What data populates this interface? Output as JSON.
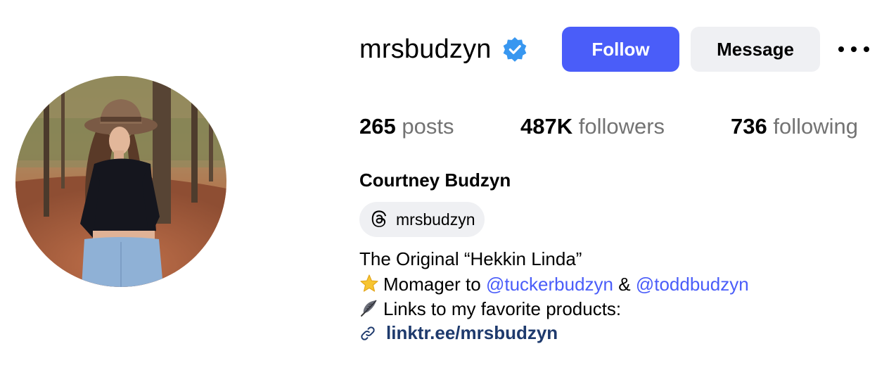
{
  "profile": {
    "username": "mrsbudzyn",
    "verified_icon": "verified-badge-icon",
    "follow_label": "Follow",
    "message_label": "Message",
    "more_icon": "more-options-icon",
    "accent_color": "#4a5df9"
  },
  "stats": {
    "posts": {
      "count": "265",
      "label": "posts"
    },
    "followers": {
      "count": "487K",
      "label": "followers"
    },
    "following": {
      "count": "736",
      "label": "following"
    }
  },
  "bio": {
    "full_name": "Courtney Budzyn",
    "threads_handle": "mrsbudzyn",
    "line1": "The Original “Hekkin Linda”",
    "line2_prefix": "Momager to",
    "line2_mention1": "@tuckerbudzyn",
    "line2_amp": "&",
    "line2_mention2": "@toddbudzyn",
    "line3": "Links to my favorite products:",
    "link": "linktr.ee/mrsbudzyn"
  }
}
